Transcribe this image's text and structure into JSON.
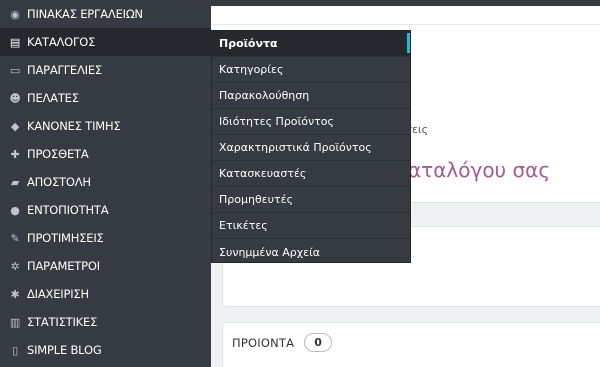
{
  "sidebar": {
    "items": [
      {
        "label": "ΠΙΝΑΚΑΣ ΕΡΓΑΛΕΙΩΝ",
        "icon": "dashboard-icon",
        "glyph": "◉"
      },
      {
        "label": "ΚΑΤΑΛΟΓΟΣ",
        "icon": "book-icon",
        "glyph": "▤",
        "active": true
      },
      {
        "label": "ΠΑΡΑΓΓΕΛΙΕΣ",
        "icon": "credit-card-icon",
        "glyph": "▭"
      },
      {
        "label": "ΠΕΛΑΤΕΣ",
        "icon": "users-icon",
        "glyph": "☻"
      },
      {
        "label": "ΚΑΝΟΝΕΣ ΤΙΜΗΣ",
        "icon": "tags-icon",
        "glyph": "◆"
      },
      {
        "label": "ΠΡΟΣΘΕΤΑ",
        "icon": "puzzle-icon",
        "glyph": "✚"
      },
      {
        "label": "ΑΠΟΣΤΟΛΗ",
        "icon": "truck-icon",
        "glyph": "▰"
      },
      {
        "label": "ΕΝΤΟΠΙΟΤΗΤΑ",
        "icon": "globe-icon",
        "glyph": "●"
      },
      {
        "label": "ΠΡΟΤΙΜΗΣΕΙΣ",
        "icon": "wrench-icon",
        "glyph": "✎"
      },
      {
        "label": "ΠΑΡΑΜΕΤΡΟΙ",
        "icon": "cogs-icon",
        "glyph": "✲"
      },
      {
        "label": "ΔΙΑΧΕΙΡΙΣΗ",
        "icon": "cog-icon",
        "glyph": "✱"
      },
      {
        "label": "ΣΤΑΤΙΣΤΙΚΕΣ",
        "icon": "bar-chart-icon",
        "glyph": "▥"
      },
      {
        "label": "SIMPLE BLOG",
        "icon": "file-icon",
        "glyph": "▯"
      }
    ]
  },
  "submenu": {
    "items": [
      {
        "label": "Προϊόντα",
        "active": true
      },
      {
        "label": "Κατηγορίες"
      },
      {
        "label": "Παρακολούθηση"
      },
      {
        "label": "Ιδιότητες Προϊόντος"
      },
      {
        "label": "Χαρακτηριστικά Προϊόντος"
      },
      {
        "label": "Κατασκευαστές"
      },
      {
        "label": "Προμηθευτές"
      },
      {
        "label": "Ετικέτες"
      },
      {
        "label": "Συνημμένα Αρχεία"
      }
    ]
  },
  "header": {
    "breadcrumb_tail": "ήσεις",
    "title_tail": "αταλόγου σας"
  },
  "products_panel": {
    "heading": "ΠΡΟΙΟΝΤΑ",
    "count": "0"
  },
  "colors": {
    "sidebar_bg": "#363a41",
    "active_bg": "#25292e",
    "accent": "#25b9d7",
    "title": "#a05d8f"
  }
}
